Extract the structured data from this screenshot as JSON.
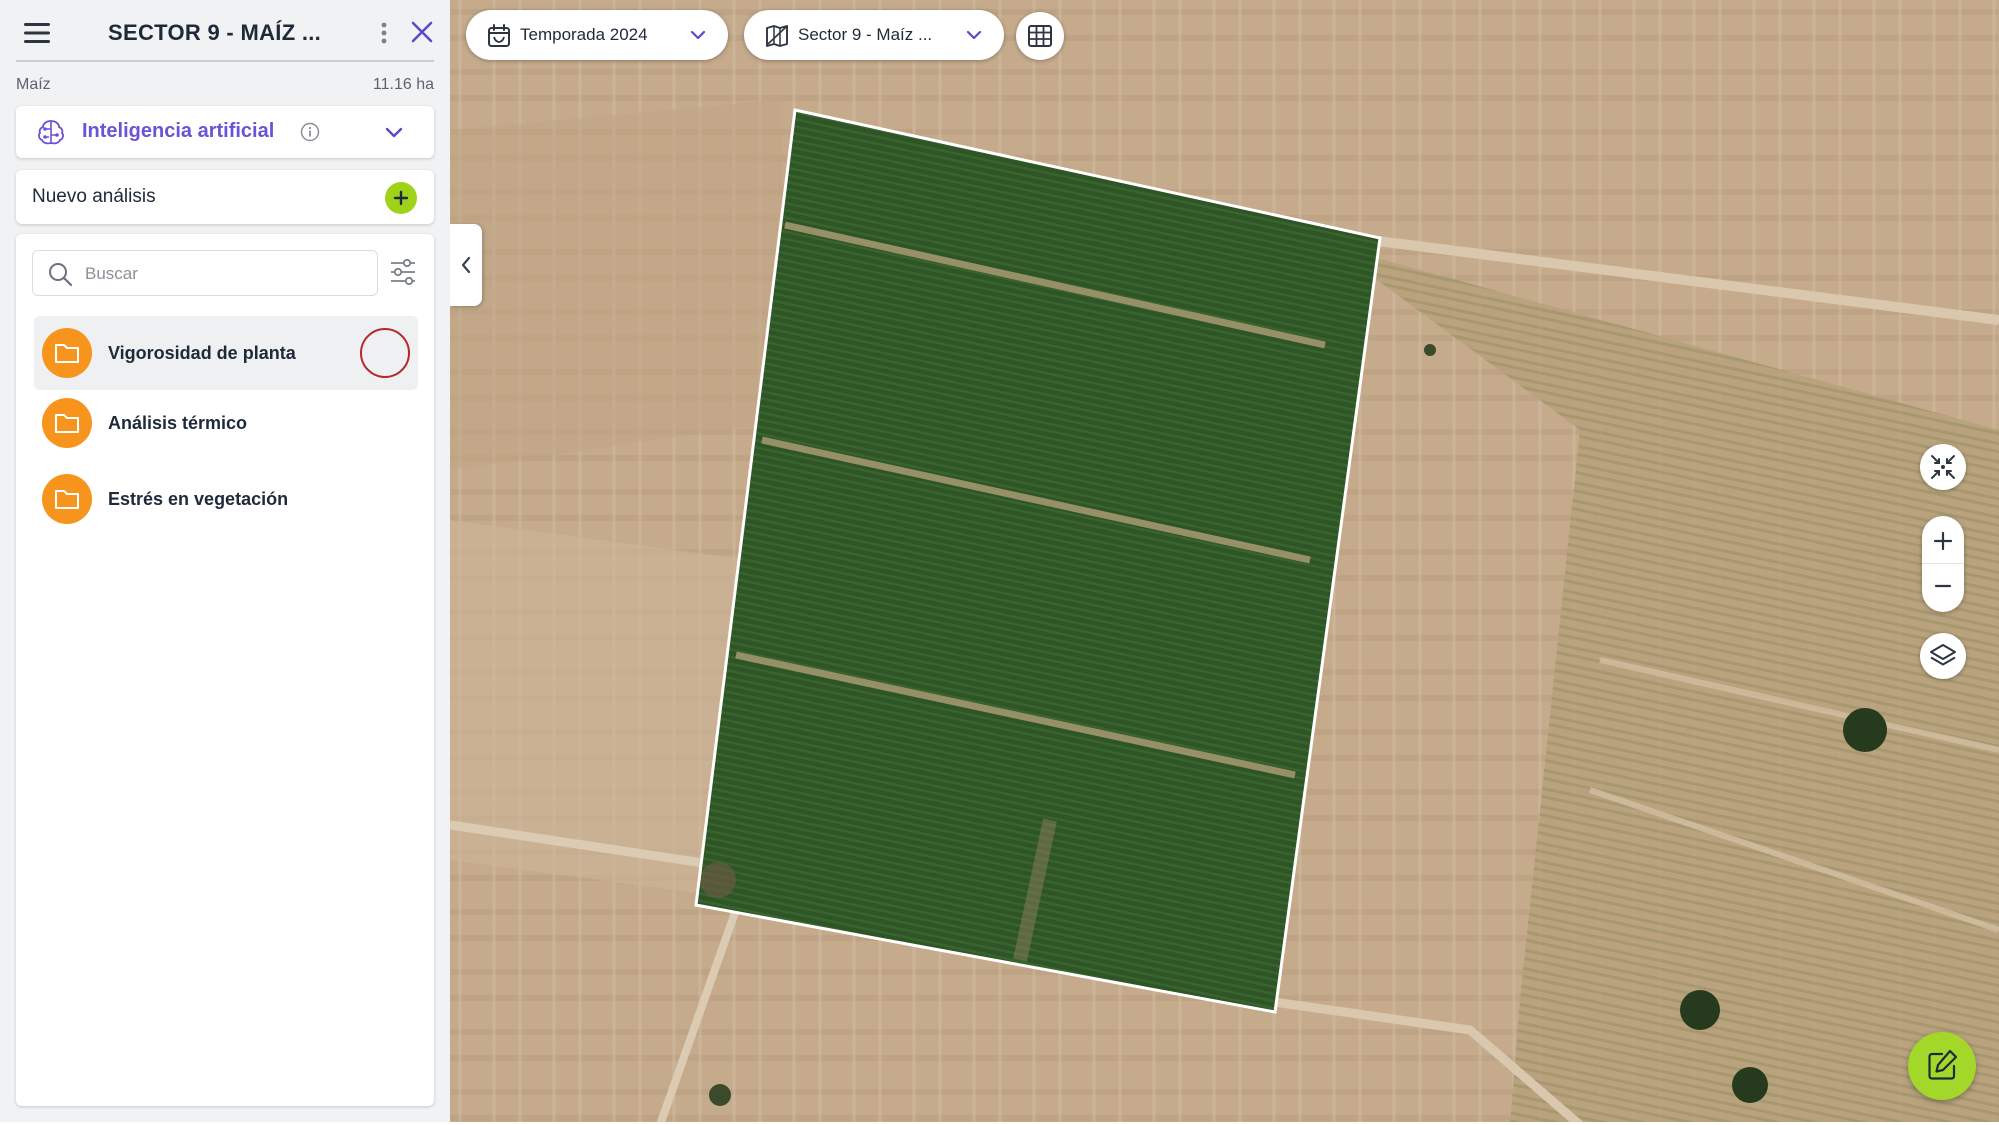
{
  "header": {
    "title": "SECTOR 9 - MAÍZ ...",
    "menu_icon": "hamburger-menu-icon",
    "more_icon": "kebab-menu-icon",
    "close_icon": "close-icon"
  },
  "field": {
    "crop": "Maíz",
    "area": "11.16 ha"
  },
  "ai_section": {
    "label": "Inteligencia artificial",
    "icon": "ai-brain-icon",
    "expanded": false
  },
  "new_analysis": {
    "label": "Nuevo análisis"
  },
  "search": {
    "placeholder": "Buscar",
    "value": ""
  },
  "folders": [
    {
      "label": "Vigorosidad de planta",
      "icon": "folder-icon",
      "selected": true
    },
    {
      "label": "Análisis térmico",
      "icon": "folder-icon",
      "selected": false
    },
    {
      "label": "Estrés en vegetación",
      "icon": "folder-icon",
      "selected": false
    }
  ],
  "map": {
    "season_selector": {
      "label": "Temporada 2024",
      "icon": "calendar-icon"
    },
    "sector_selector": {
      "label": "Sector 9 - Maíz ...",
      "icon": "field-map-icon"
    },
    "controls": [
      "table-view-icon",
      "fit-bounds-icon",
      "zoom-in-icon",
      "zoom-out-icon",
      "layers-icon",
      "edit-icon"
    ]
  },
  "colors": {
    "accent_purple": "#6c52d6",
    "lime_green": "#9fd31a",
    "folder_orange": "#f7941d",
    "selection_ring": "#b22a2a",
    "field_green": "#2f5426",
    "soil": "#c7ad8e"
  }
}
